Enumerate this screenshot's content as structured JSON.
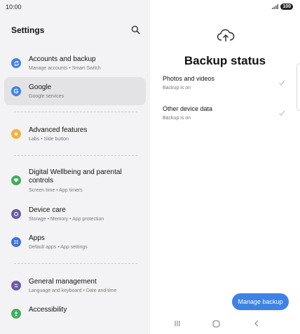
{
  "status_bar": {
    "time": "10:00",
    "battery": "100"
  },
  "left": {
    "title": "Settings",
    "items": [
      {
        "title": "Accounts and backup",
        "subtitle": "Manage accounts • Smart Switch"
      },
      {
        "title": "Google",
        "subtitle": "Google services"
      },
      {
        "title": "Advanced features",
        "subtitle": "Labs • Side button"
      },
      {
        "title": "Digital Wellbeing and parental controls",
        "subtitle": "Screen time • App timers"
      },
      {
        "title": "Device care",
        "subtitle": "Storage • Memory • App protection"
      },
      {
        "title": "Apps",
        "subtitle": "Default apps • App settings"
      },
      {
        "title": "General management",
        "subtitle": "Language and keyboard • Date and time"
      },
      {
        "title": "Accessibility",
        "subtitle": ""
      }
    ]
  },
  "right": {
    "title": "Backup status",
    "rows": [
      {
        "title": "Photos and videos",
        "subtitle": "Backup is on"
      },
      {
        "title": "Other device data",
        "subtitle": "Backup is on"
      }
    ],
    "button_label": "Manage backup"
  },
  "colors": {
    "accent": "#3e82e6",
    "left_bg": "#f3f3f5",
    "selected_bg": "#e3e3e6"
  },
  "icons": [
    "search-icon",
    "sync-icon",
    "google-icon",
    "star-icon",
    "heart-icon",
    "device-care-icon",
    "apps-icon",
    "sliders-icon",
    "accessibility-icon",
    "cloud-upload-icon",
    "check-icon",
    "recents-icon",
    "home-icon",
    "back-icon"
  ]
}
